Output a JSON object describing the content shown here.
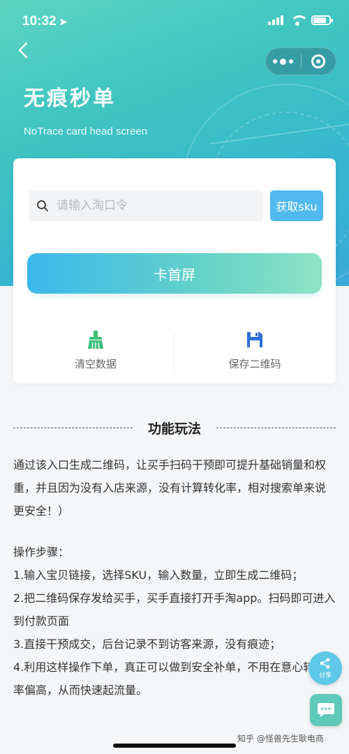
{
  "status_bar": {
    "time": "10:32",
    "battery_level": 0.8
  },
  "header": {
    "title": "无痕秒单",
    "subtitle": "NoTrace card head screen"
  },
  "search": {
    "placeholder": "请输入淘口令",
    "value": ""
  },
  "buttons": {
    "get_sku": "获取sku",
    "main": "卡首屏",
    "clear": "清空数据",
    "save_qr": "保存二维码"
  },
  "section": {
    "title": "功能玩法"
  },
  "intro": "通过该入口生成二维码，让买手扫码干预即可提升基础销量和权重，并且因为没有入店来源，没有计算转化率，相对搜索单来说更安全！）",
  "steps": {
    "heading": "操作步骤：",
    "items": [
      "1.输入宝贝链接，选择SKU，输入数量，立即生成二维码；",
      "2.把二维码保存发给买手，买手直接打开手淘app。扫码即可进入到付款页面",
      "3.直接干预成交，后台记录不到访客来源，没有痕迹；",
      "4.利用这样操作下单，真正可以做到安全补单，不用在意心转化率偏高，从而快速起流量。"
    ]
  },
  "fab": {
    "share_label": "分享"
  },
  "watermark": "知乎 @怪兽先生耿电商",
  "colors": {
    "accent": "#4fb9f0",
    "gradient_start": "#3bb7ec",
    "gradient_end": "#8ee3c4",
    "clear_icon": "#3cc07a",
    "save_icon": "#2f6fd6"
  },
  "icons": {
    "back": "chevron-left-icon",
    "search": "search-icon",
    "clear": "broom-icon",
    "save": "floppy-disk-icon",
    "share": "share-icon",
    "chat": "chat-icon"
  }
}
